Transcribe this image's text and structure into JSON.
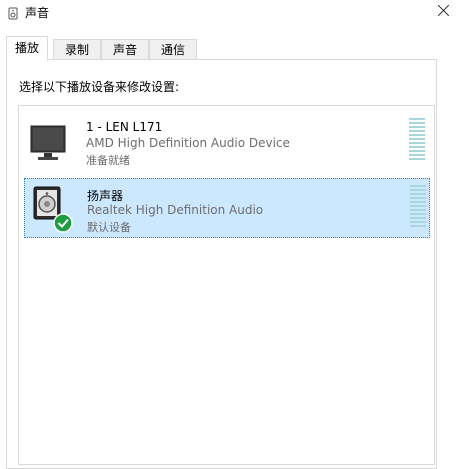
{
  "window": {
    "title": "声音",
    "icon": "speaker-icon",
    "close_icon": "close-icon"
  },
  "tabs": [
    {
      "label": "播放",
      "active": true
    },
    {
      "label": "录制",
      "active": false
    },
    {
      "label": "声音",
      "active": false
    },
    {
      "label": "通信",
      "active": false
    }
  ],
  "playback": {
    "instruction": "选择以下播放设备来修改设置:",
    "devices": [
      {
        "name": "1 - LEN L171",
        "description": "AMD High Definition Audio Device",
        "status": "准备就绪",
        "icon": "monitor-icon",
        "selected": false
      },
      {
        "name": "扬声器",
        "description": "Realtek High Definition Audio",
        "status": "默认设备",
        "icon": "speaker-device-icon",
        "default_badge_icon": "check-badge-icon",
        "selected": true
      }
    ]
  },
  "colors": {
    "selection": "#cce8ff",
    "selection_border": "#3c7fb1",
    "meter": "#a9d5dc",
    "check": "#1e9e3e"
  }
}
